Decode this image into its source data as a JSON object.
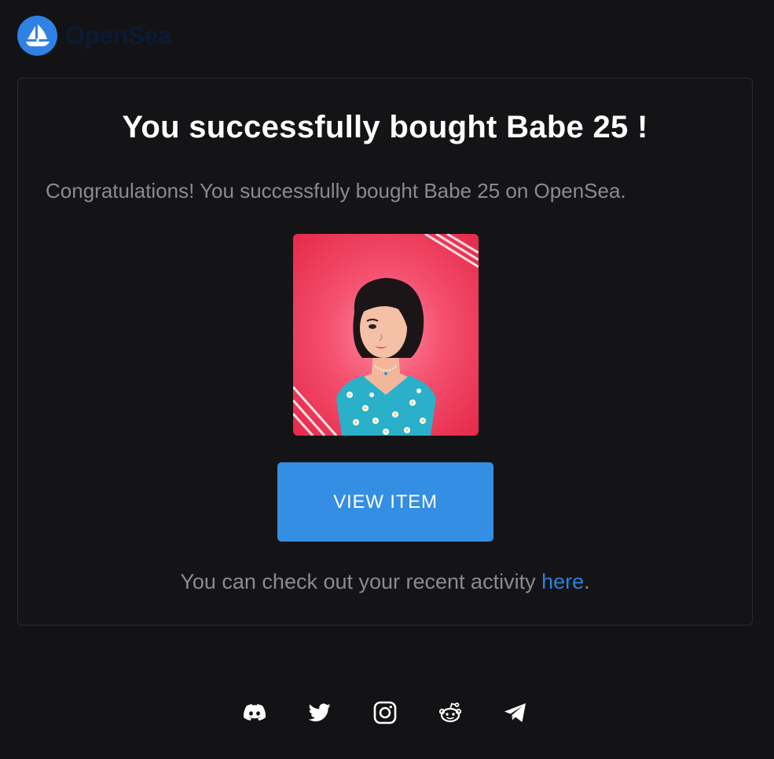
{
  "brand": {
    "name": "OpenSea",
    "logo_icon": "opensea-boat-icon",
    "logo_color": "#2f81e4"
  },
  "card": {
    "title": "You successfully bought Babe 25 !",
    "subtitle": "Congratulations! You successfully bought Babe 25 on OpenSea.",
    "nft_image": {
      "alt": "Babe 25 NFT illustration",
      "background_color": "#f24766"
    },
    "button_label": "VIEW ITEM",
    "button_color": "#348ee3",
    "activity_text": "You can check out your recent activity ",
    "activity_link": "here",
    "activity_suffix": ".",
    "link_color": "#2f80d9"
  },
  "footer": {
    "social_icons": [
      "discord-icon",
      "twitter-icon",
      "instagram-icon",
      "reddit-icon",
      "telegram-icon"
    ]
  }
}
